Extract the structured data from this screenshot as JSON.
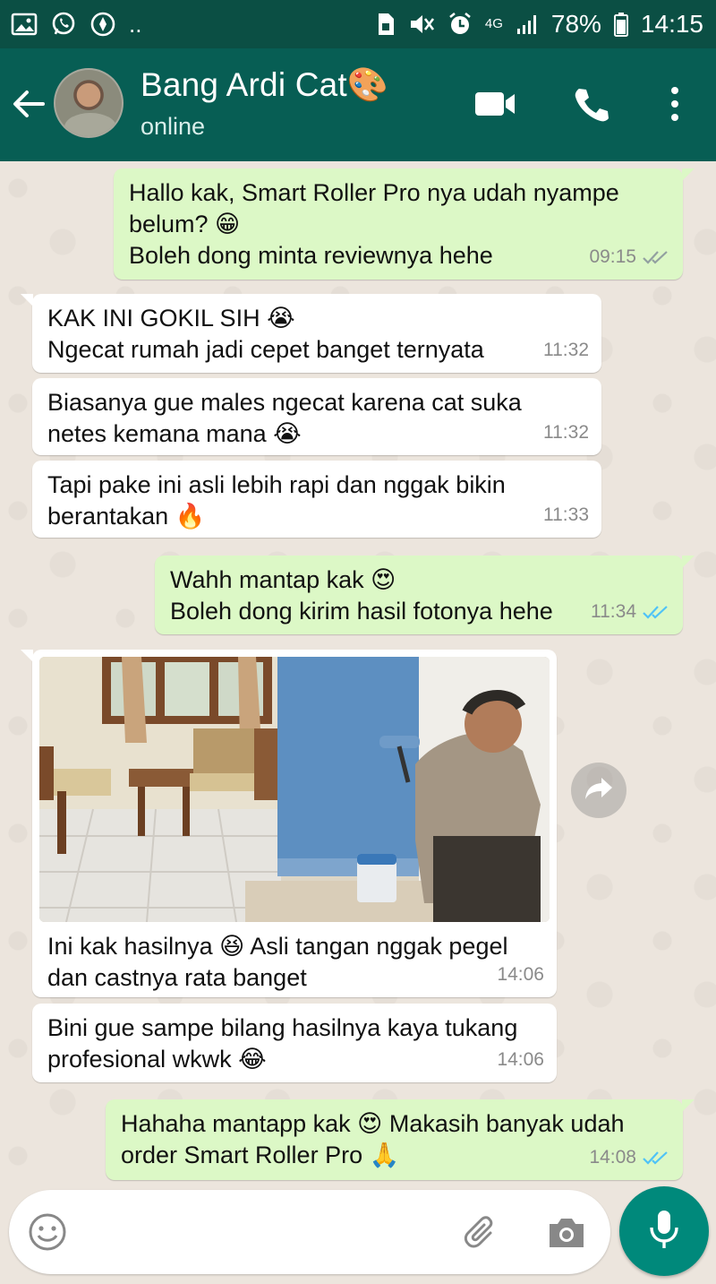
{
  "status_bar": {
    "left_icons": [
      "image-icon",
      "whatsapp-icon",
      "compass-icon"
    ],
    "dots": "..",
    "network": "4G",
    "battery": "78%",
    "time": "14:15"
  },
  "header": {
    "contact_name": "Bang Ardi Cat🎨",
    "status": "online"
  },
  "messages": [
    {
      "dir": "out",
      "lines": [
        "Hallo kak, Smart Roller Pro nya udah nyampe",
        "belum? 😁",
        "Boleh dong minta reviewnya hehe"
      ],
      "time": "09:15",
      "ticks": "read-grey"
    },
    {
      "dir": "in",
      "lines": [
        "KAK INI GOKIL SIH 😭",
        "Ngecat rumah jadi cepet banget ternyata"
      ],
      "time": "11:32"
    },
    {
      "dir": "in",
      "lines": [
        "Biasanya gue males ngecat karena cat suka",
        "netes kemana mana 😭"
      ],
      "time": "11:32"
    },
    {
      "dir": "in",
      "lines": [
        "Tapi pake ini asli lebih rapi dan nggak bikin",
        "berantakan 🔥"
      ],
      "time": "11:33"
    },
    {
      "dir": "out",
      "lines": [
        "Wahh mantap kak 😍",
        "Boleh dong kirim hasil fotonya hehe"
      ],
      "time": "11:34",
      "ticks": "read-blue"
    },
    {
      "dir": "in",
      "type": "photo",
      "lines": [
        "Ini kak hasilnya 😆 Asli tangan nggak pegel",
        "dan castnya rata banget"
      ],
      "time": "14:06"
    },
    {
      "dir": "in",
      "lines": [
        "Bini gue sampe bilang hasilnya kaya tukang",
        "profesional wkwk 😂"
      ],
      "time": "14:06"
    },
    {
      "dir": "out",
      "lines": [
        "Hahaha mantapp kak 😍 Makasih banyak udah",
        "order Smart Roller Pro 🙏"
      ],
      "time": "14:08",
      "ticks": "read-blue"
    }
  ],
  "input": {
    "placeholder": "",
    "value": ""
  },
  "colors": {
    "header": "#075e54",
    "status_bar": "#0b4f44",
    "outgoing_bubble": "#dcf8c6",
    "incoming_bubble": "#ffffff",
    "read_tick_blue": "#4fc3f7",
    "mic_button": "#00897b"
  }
}
